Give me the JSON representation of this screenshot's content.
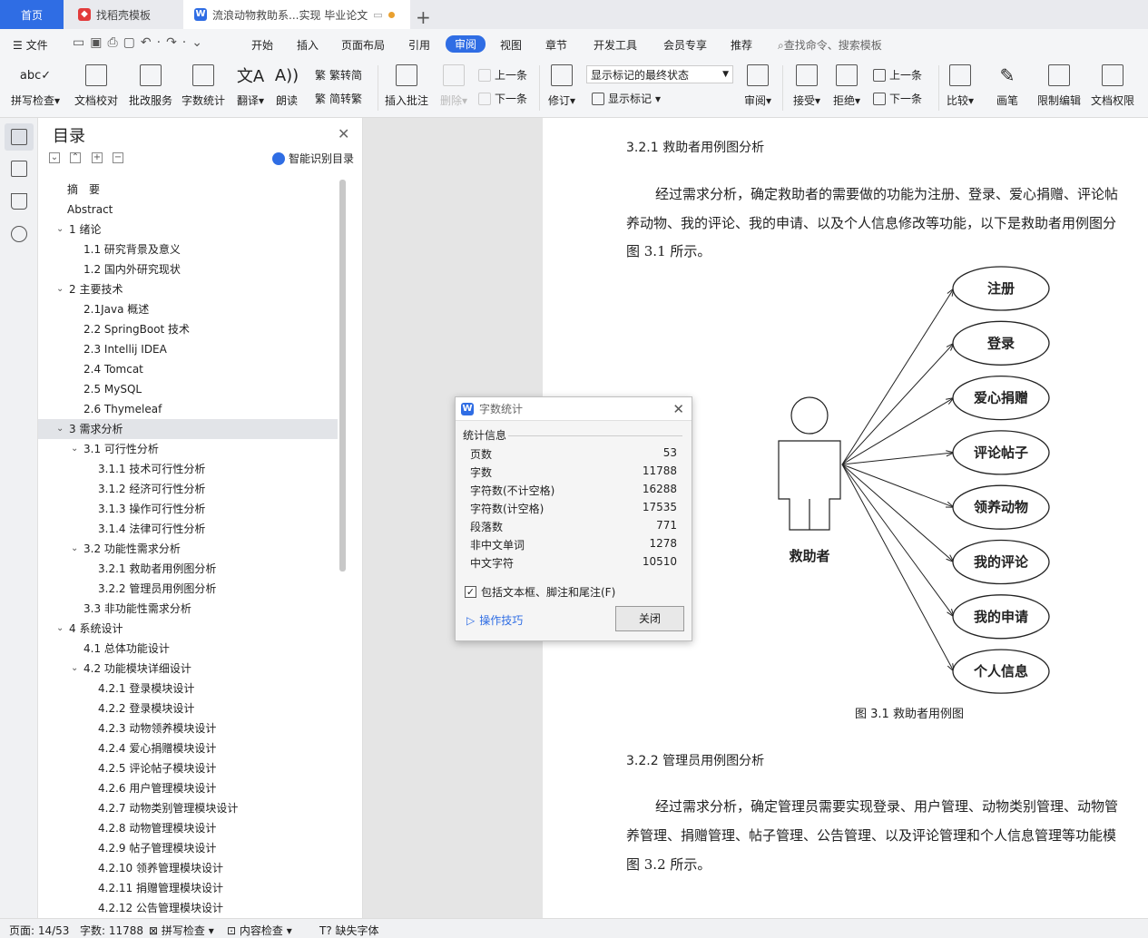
{
  "tabs": {
    "home": "首页",
    "template": "找稻壳模板",
    "doc": "流浪动物救助系...实现 毕业论文"
  },
  "menu": {
    "file": "文件",
    "items": [
      "开始",
      "插入",
      "页面布局",
      "引用",
      "审阅",
      "视图",
      "章节",
      "开发工具",
      "会员专享",
      "推荐"
    ],
    "search": "查找命令、搜索模板"
  },
  "ribbon": {
    "spell": "拼写检查",
    "proof": "文档校对",
    "batch": "批改服务",
    "wordcount": "字数统计",
    "translate": "翻译",
    "read": "朗读",
    "trad": "繁转简",
    "simp": "简转繁",
    "insert_comment": "插入批注",
    "delete": "删除",
    "prev": "上一条",
    "next": "下一条",
    "revise": "修订",
    "markup_select": "显示标记的最终状态",
    "show_markup": "显示标记",
    "review": "审阅",
    "accept": "接受",
    "reject": "拒绝",
    "prev2": "上一条",
    "next2": "下一条",
    "compare": "比较",
    "pen": "画笔",
    "restrict": "限制编辑",
    "perm": "文档权限"
  },
  "toc": {
    "title": "目录",
    "smart": "智能识别目录",
    "items": [
      {
        "text": "摘　要",
        "level": 0
      },
      {
        "text": "Abstract",
        "level": 0
      },
      {
        "text": "1  绪论",
        "level": 1
      },
      {
        "text": "1.1 研究背景及意义",
        "level": 2
      },
      {
        "text": "1.2 国内外研究现状",
        "level": 2
      },
      {
        "text": "2  主要技术",
        "level": 1
      },
      {
        "text": "2.1Java 概述",
        "level": 2
      },
      {
        "text": "2.2 SpringBoot 技术",
        "level": 2
      },
      {
        "text": "2.3 Intellij IDEA",
        "level": 2
      },
      {
        "text": "2.4 Tomcat",
        "level": 2
      },
      {
        "text": "2.5 MySQL",
        "level": 2
      },
      {
        "text": "2.6 Thymeleaf",
        "level": 2
      },
      {
        "text": "3  需求分析",
        "level": 1,
        "selected": true
      },
      {
        "text": "3.1 可行性分析",
        "level": 2,
        "chev": true
      },
      {
        "text": "3.1.1  技术可行性分析",
        "level": 3
      },
      {
        "text": "3.1.2  经济可行性分析",
        "level": 3
      },
      {
        "text": "3.1.3  操作可行性分析",
        "level": 3
      },
      {
        "text": "3.1.4  法律可行性分析",
        "level": 3
      },
      {
        "text": "3.2  功能性需求分析",
        "level": 2,
        "chev": true
      },
      {
        "text": "3.2.1 救助者用例图分析",
        "level": 3
      },
      {
        "text": "3.2.2  管理员用例图分析",
        "level": 3
      },
      {
        "text": "3.3  非功能性需求分析",
        "level": 2
      },
      {
        "text": "4  系统设计",
        "level": 1
      },
      {
        "text": "4.1  总体功能设计",
        "level": 2
      },
      {
        "text": "4.2  功能模块详细设计",
        "level": 2,
        "chev": true
      },
      {
        "text": "4.2.1  登录模块设计",
        "level": 3
      },
      {
        "text": "4.2.2  登录模块设计",
        "level": 3
      },
      {
        "text": "4.2.3  动物领养模块设计",
        "level": 3
      },
      {
        "text": "4.2.4 爱心捐赠模块设计",
        "level": 3
      },
      {
        "text": "4.2.5 评论帖子模块设计",
        "level": 3
      },
      {
        "text": "4.2.6 用户管理模块设计",
        "level": 3
      },
      {
        "text": "4.2.7 动物类别管理模块设计",
        "level": 3
      },
      {
        "text": "4.2.8 动物管理模块设计",
        "level": 3
      },
      {
        "text": "4.2.9 帖子管理模块设计",
        "level": 3
      },
      {
        "text": "4.2.10 领养管理模块设计",
        "level": 3
      },
      {
        "text": "4.2.11 捐赠管理模块设计",
        "level": 3
      },
      {
        "text": "4.2.12 公告管理模块设计",
        "level": 3
      }
    ]
  },
  "page": {
    "h1": "3.2.1 救助者用例图分析",
    "p1_l1": "经过需求分析，确定救助者的需要做的功能为注册、登录、爱心捐赠、评论帖",
    "p1_l2": "养动物、我的评论、我的申请、以及个人信息修改等功能，以下是救助者用例图分",
    "p1_l3": "图 3.1 所示。",
    "actor": "救助者",
    "usecases": [
      "注册",
      "登录",
      "爱心捐赠",
      "评论帖子",
      "领养动物",
      "我的评论",
      "我的申请",
      "个人信息"
    ],
    "caption": "图 3.1 救助者用例图",
    "h2": "3.2.2  管理员用例图分析",
    "p2_l1": "经过需求分析，确定管理员需要实现登录、用户管理、动物类别管理、动物管",
    "p2_l2": "养管理、捐赠管理、帖子管理、公告管理、以及评论管理和个人信息管理等功能模",
    "p2_l3": "图 3.2 所示。"
  },
  "dialog": {
    "title": "字数统计",
    "section": "统计信息",
    "rows": [
      {
        "k": "页数",
        "v": "53"
      },
      {
        "k": "字数",
        "v": "11788"
      },
      {
        "k": "字符数(不计空格)",
        "v": "16288"
      },
      {
        "k": "字符数(计空格)",
        "v": "17535"
      },
      {
        "k": "段落数",
        "v": "771"
      },
      {
        "k": "非中文单词",
        "v": "1278"
      },
      {
        "k": "中文字符",
        "v": "10510"
      }
    ],
    "checkbox": "包括文本框、脚注和尾注(F)",
    "checked": true,
    "tips": "操作技巧",
    "close": "关闭"
  },
  "status": {
    "page": "页面: 14/53",
    "words": "字数: 11788",
    "spell": "拼写检查",
    "content": "内容检查",
    "font": "缺失字体"
  }
}
